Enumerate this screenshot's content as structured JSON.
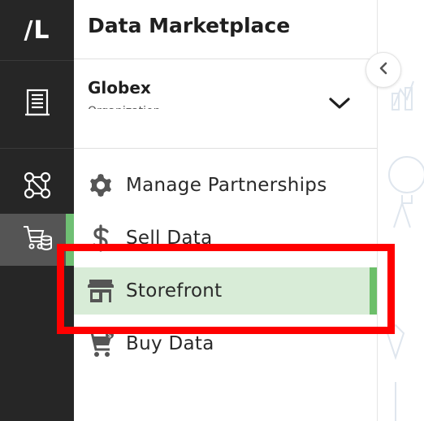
{
  "rail": {
    "logo": "/L",
    "items": [
      {
        "icon": "building-icon"
      },
      {
        "icon": "network-nodes-icon"
      },
      {
        "icon": "cart-database-icon",
        "active": true
      }
    ]
  },
  "panel": {
    "title": "Data Marketplace",
    "org": {
      "name": "Globex",
      "subtitle": "Organization"
    },
    "menu": [
      {
        "label": "Manage Partnerships",
        "icon": "gear-icon"
      },
      {
        "label": "Sell Data",
        "icon": "dollar-icon"
      },
      {
        "label": "Storefront",
        "icon": "storefront-icon",
        "active": true
      },
      {
        "label": "Buy Data",
        "icon": "cart-icon"
      }
    ]
  },
  "colors": {
    "rail_bg": "#262626",
    "active_green": "#6cbf6a",
    "active_bg": "#d8ecd7",
    "highlight": "#ff0000"
  }
}
